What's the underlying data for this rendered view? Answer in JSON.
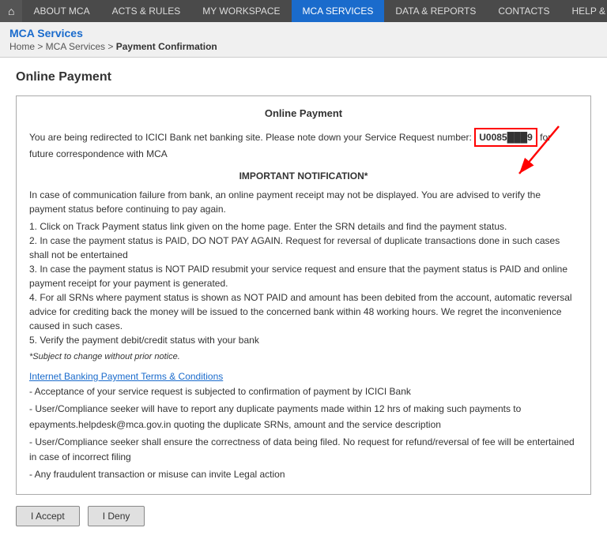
{
  "nav": {
    "home_icon": "⌂",
    "items": [
      {
        "label": "ABOUT MCA",
        "active": false
      },
      {
        "label": "ACTS & RULES",
        "active": false
      },
      {
        "label": "MY WORKSPACE",
        "active": false
      },
      {
        "label": "MCA SERVICES",
        "active": true
      },
      {
        "label": "DATA & REPORTS",
        "active": false
      },
      {
        "label": "CONTACTS",
        "active": false
      },
      {
        "label": "HELP & FAQS",
        "active": false
      }
    ]
  },
  "breadcrumb": {
    "site_title": "MCA Services",
    "path": "Home > MCA Services >",
    "current": "Payment Confirmation"
  },
  "page": {
    "heading": "Online Payment",
    "box_title": "Online Payment",
    "redirect_text_before": "You are being redirected to ICICI Bank net banking site. Please note down your Service Request number:",
    "srn_value": "U0085███9",
    "redirect_text_after": "for future correspondence with MCA",
    "important_title": "IMPORTANT NOTIFICATION*",
    "important_intro": "In case of communication failure from bank, an online payment receipt may not be displayed. You are advised to verify the payment status before continuing to pay again.",
    "steps": [
      "1. Click on Track Payment status link given on the home page. Enter the SRN details and find the payment status.",
      "2. In case the payment status is PAID, DO NOT PAY AGAIN. Request for reversal of duplicate transactions done in such cases shall not be entertained",
      "3. In case the payment status is NOT PAID resubmit your service request and ensure that the payment status is PAID and online payment receipt for your payment is generated.",
      "4. For all SRNs where payment status is shown as NOT PAID and amount has been debited from the account, automatic reversal advice for crediting back the money will be issued to the concerned bank within 48 working hours. We regret the inconvenience caused in such cases.",
      "5. Verify the payment debit/credit status with your bank"
    ],
    "small_note": "*Subject to change without prior notice.",
    "terms_link": "Internet Banking Payment Terms & Conditions",
    "terms": [
      "- Acceptance of your service request is subjected to confirmation of payment by ICICI Bank",
      "- User/Compliance seeker will have to report any duplicate payments made within 12 hrs of making such payments to epayments.helpdesk@mca.gov.in quoting the duplicate SRNs, amount and the service description",
      "- User/Compliance seeker shall ensure the correctness of data being filed. No request for refund/reversal of fee will be entertained in case of incorrect filing",
      "- Any fraudulent transaction or misuse can invite Legal action"
    ],
    "accept_btn": "I Accept",
    "deny_btn": "I Deny"
  }
}
